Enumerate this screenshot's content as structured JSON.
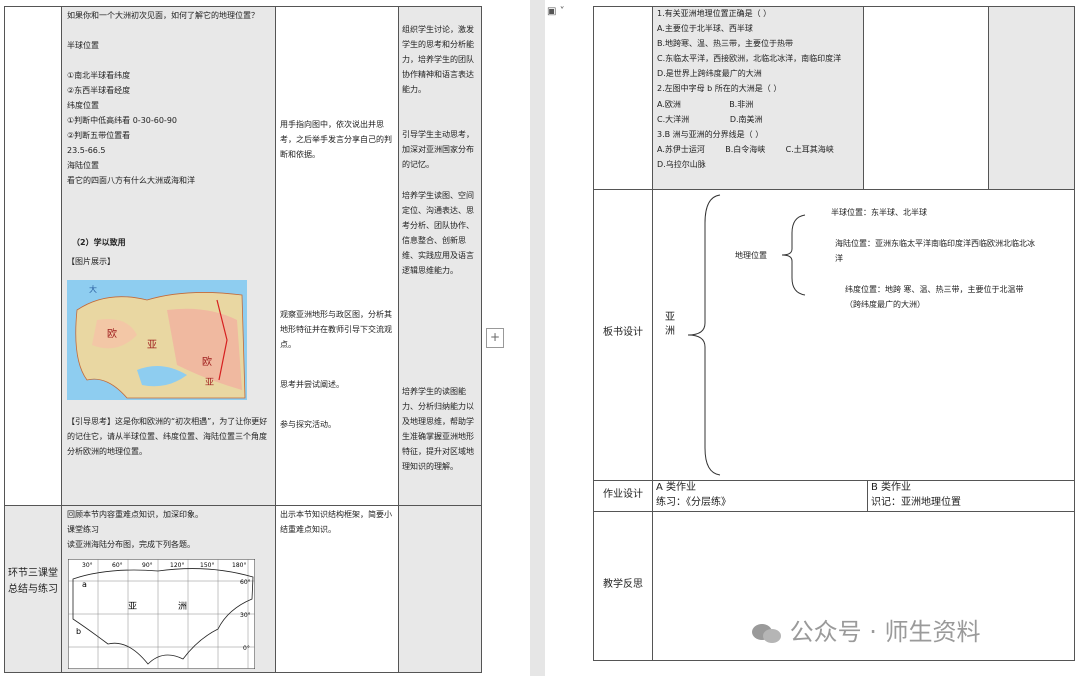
{
  "left": {
    "col2_lines": [
      "如果你和一个大洲初次见面，如何了解它的地理位置？",
      "半球位置",
      "",
      "①南北半球看纬度",
      "②东西半球看经度",
      "纬度位置",
      "①判断中低高纬看 0-30-60-90",
      "②判断五带位置看",
      "23.5-66.5",
      "海陆位置",
      "看它的四面八方有什么大洲或海和洋"
    ],
    "learn_heading": "（2）学以致用",
    "image_label": "【图片展示】",
    "map_labels": [
      "大",
      "欧",
      "亚",
      "欧",
      "亚"
    ],
    "guide_text": "【引导思考】这是你和欧洲的“初次相遇”，为了让你更好的记住它，请从半球位置、纬度位置、海陆位置三个角度分析欧洲的地理位置。",
    "col3_a": "用手指向图中，依次说出并思考，之后举手发言分享自己的判断和依据。",
    "col3_b": "观察亚洲地形与政区图，分析其地形特征并在教师引导下交流观点。",
    "col3_c": "思考并尝试阐述。",
    "col3_d": "参与探究活动。",
    "col4_a": "组织学生讨论，激发学生的思考和分析能力，培养学生的团队协作精神和语言表达能力。",
    "col4_b": "引导学生主动思考，加深对亚洲国家分布的记忆。",
    "col4_c": "培养学生读图、空间定位、沟通表达、思考分析、团队协作、信息整合、创新思维、实践应用及语言逻辑思维能力。",
    "col4_d": "培养学生的读图能力、分析归纳能力以及地理思维，帮助学生准确掌握亚洲地形特征，提升对区域地理知识的理解。",
    "stage3_label": "环节三课堂总结与练习",
    "stage3_lines": [
      "回顾本节内容重难点知识，加深印象。",
      "课堂练习",
      "读亚洲海陆分布图，完成下列各题。"
    ],
    "stage3_col3": "出示本节知识结构框架，简要小结重难点知识。",
    "grid_lon": [
      "30°",
      "60°",
      "90°",
      "120°",
      "150°",
      "180°"
    ],
    "grid_lat": [
      "60°",
      "30°",
      "0°"
    ],
    "grid_labels": [
      "亚",
      "洲",
      "a",
      "b"
    ]
  },
  "right": {
    "quiz_lines": [
      "1.有关亚洲地理位置正确是（    ）",
      "A.主要位于北半球、西半球",
      "B.地跨寒、温、热三带，主要位于热带",
      "C.东临太平洋，西接欧洲，北临北冰洋，南临印度洋",
      "D.是世界上跨纬度最广的大洲",
      "2.左图中字母 b 所在的大洲是（    ）",
      "A.欧洲                   B.非洲",
      "C.大洋洲                D.南美洲",
      "3.B 洲与亚洲的分界线是（    ）",
      "A.苏伊士运河        B.白令海峡        C.土耳其海峡",
      "D.乌拉尔山脉"
    ],
    "board_label": "板书设计",
    "asia_char_1": "亚",
    "asia_char_2": "洲",
    "geo_pos": "地理位置",
    "hemisphere": "半球位置：东半球、北半球",
    "sea_land": "海陆位置：亚洲东临太平洋南临印度洋西临欧洲北临北冰洋",
    "latitude": "纬度位置：地跨   寒、温、热三带，主要位于北温带（跨纬度最广的大洲）",
    "hw_label": "作业设计",
    "hw_a_title": "A 类作业",
    "hw_a_body": "练习：《分层练》",
    "hw_b_title": "B 类作业",
    "hw_b_body": "识记：亚洲地理位置",
    "reflect_label": "教学反思",
    "watermark": "公众号 · 师生资料"
  },
  "toolbar": {
    "view_icon": "page-view-icon",
    "plus_icon": "add-icon"
  }
}
